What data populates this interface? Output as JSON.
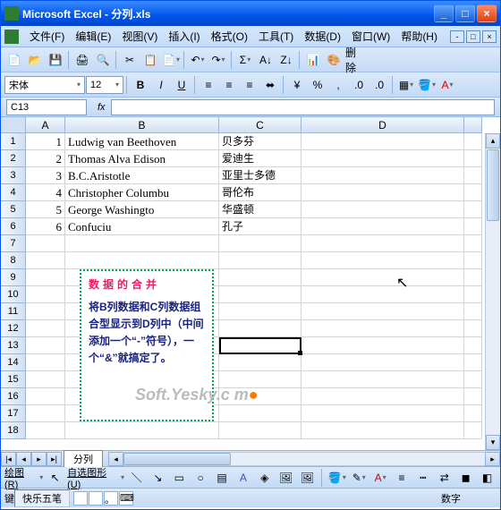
{
  "window": {
    "title": "Microsoft Excel - 分列.xls"
  },
  "menu": {
    "file": "文件(F)",
    "edit": "编辑(E)",
    "view": "视图(V)",
    "insert": "插入(I)",
    "format": "格式(O)",
    "tools": "工具(T)",
    "data": "数据(D)",
    "window": "窗口(W)",
    "help": "帮助(H)"
  },
  "format_toolbar": {
    "font": "宋体",
    "size": "12"
  },
  "namebox": "C13",
  "columns": [
    "A",
    "B",
    "C",
    "D"
  ],
  "rows": [
    {
      "n": "1",
      "a": "1",
      "b": "Ludwig van Beethoven",
      "c": "贝多芬"
    },
    {
      "n": "2",
      "a": "2",
      "b": "Thomas Alva Edison",
      "c": "爱迪生"
    },
    {
      "n": "3",
      "a": "3",
      "b": "B.C.Aristotle",
      "c": "亚里士多德"
    },
    {
      "n": "4",
      "a": "4",
      "b": "Christopher Columbu",
      "c": "哥伦布"
    },
    {
      "n": "5",
      "a": "5",
      "b": "George Washingto",
      "c": "华盛顿"
    },
    {
      "n": "6",
      "a": "6",
      "b": "Confuciu",
      "c": "孔子"
    }
  ],
  "blank_rows": [
    "7",
    "8",
    "9",
    "10",
    "11",
    "12",
    "13",
    "14",
    "15",
    "16",
    "17",
    "18"
  ],
  "textbox": {
    "title": "数据的合并",
    "body": "将B列数据和C列数据组合型显示到D列中（中间添加一个“-”符号），一个“&”就搞定了。"
  },
  "watermark": "Soft.Yesky.c   m",
  "sheet": {
    "tab": "分列"
  },
  "drawbar": {
    "draw": "绘图(R)",
    "autoshape": "自选图形(U)"
  },
  "statusbar": {
    "ime": "快乐五笔",
    "numlock": "数字"
  }
}
